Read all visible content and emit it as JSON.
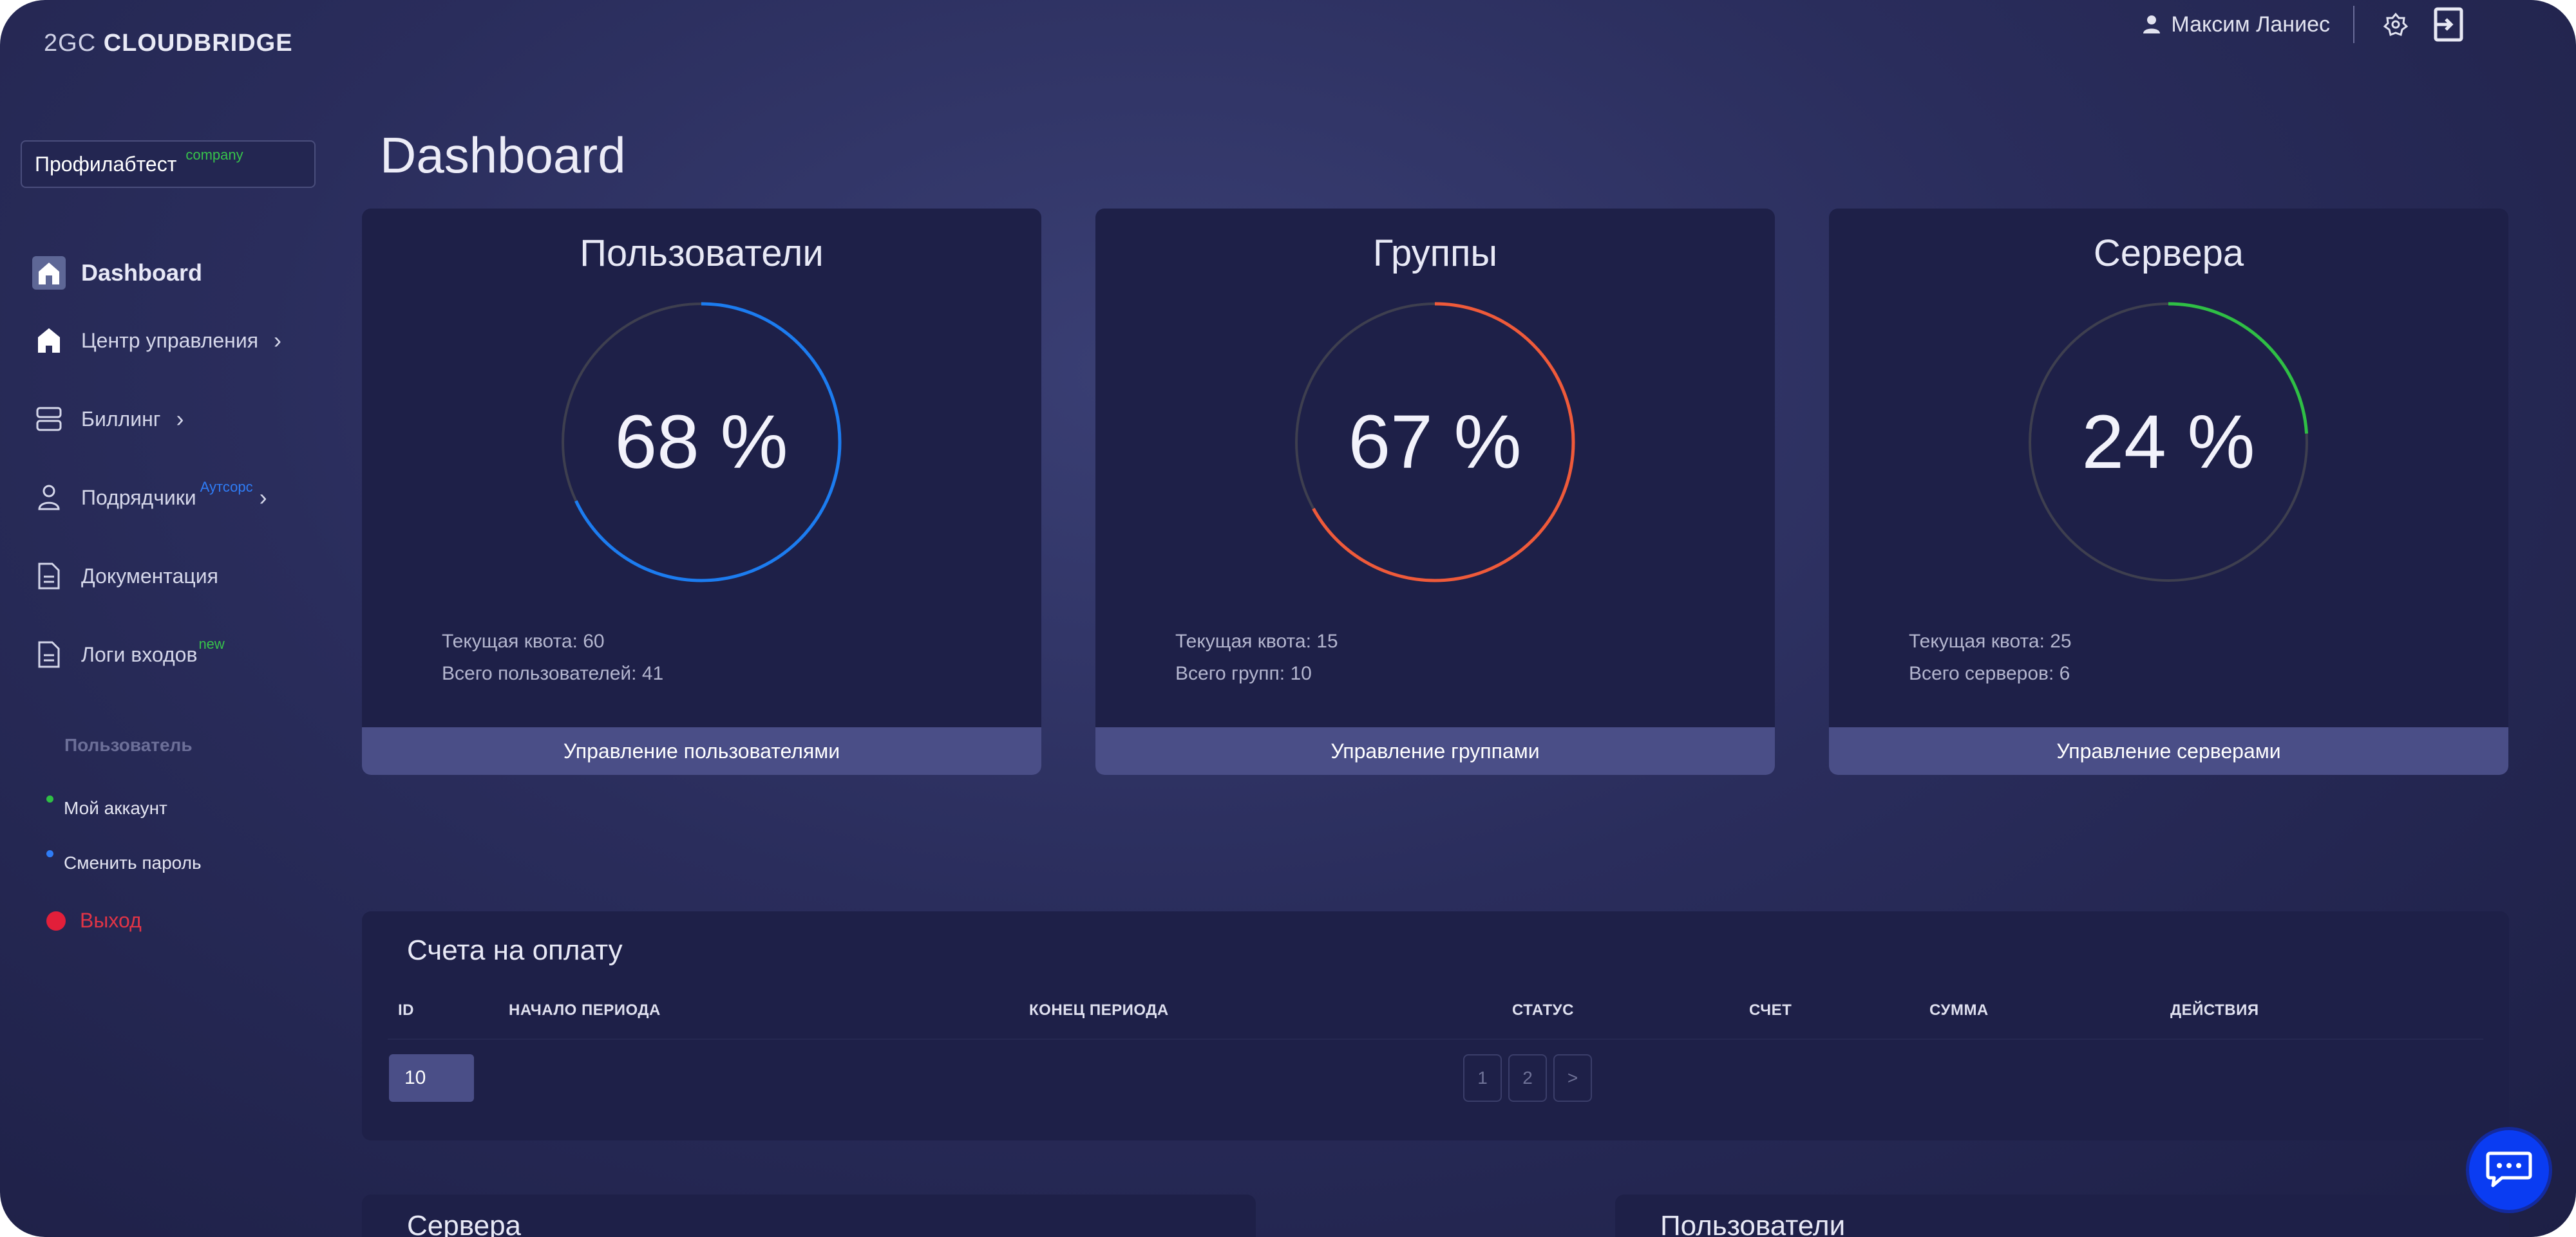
{
  "brand": {
    "prefix": "2GC",
    "name": "CLOUDBRIDGE"
  },
  "header": {
    "user_name": "Максим Ланиес",
    "icons": [
      "user-icon",
      "settings-icon",
      "logout-icon"
    ]
  },
  "company": {
    "name": "Профилабтест",
    "badge": "company"
  },
  "sidebar": {
    "dashboard": "Dashboard",
    "items": [
      {
        "label": "Центр управления",
        "icon": "home-icon",
        "chevron": true
      },
      {
        "label": "Биллинг",
        "icon": "server-icon",
        "chevron": true
      },
      {
        "label": "Подрядчики",
        "icon": "person-icon",
        "badge": "Аутсорс",
        "chevron": true
      },
      {
        "label": "Документация",
        "icon": "document-icon"
      },
      {
        "label": "Логи входов",
        "icon": "document-icon",
        "badge": "new"
      }
    ],
    "section_title": "Пользователь",
    "account_links": [
      {
        "label": "Мой аккаунт",
        "dot_color": "#2fbf45"
      },
      {
        "label": "Сменить пароль",
        "dot_color": "#2f7cf6"
      }
    ],
    "logout": "Выход"
  },
  "page": {
    "title": "Dashboard"
  },
  "cards": [
    {
      "title": "Пользователи",
      "percent": 68,
      "percent_text": "68 %",
      "color": "#1c7cf0",
      "quota": "Текущая квота: 60",
      "total": "Всего пользователей: 41",
      "button": "Управление пользователями"
    },
    {
      "title": "Группы",
      "percent": 67,
      "percent_text": "67 %",
      "color": "#ef5a3a",
      "quota": "Текущая квота: 15",
      "total": "Всего групп: 10",
      "button": "Управление группами"
    },
    {
      "title": "Сервера",
      "percent": 24,
      "percent_text": "24 %",
      "color": "#2fbf45",
      "quota": "Текущая квота: 25",
      "total": "Всего серверов: 6",
      "button": "Управление серверами"
    }
  ],
  "invoices": {
    "title": "Счета на оплату",
    "columns": [
      "ID",
      "НАЧАЛО ПЕРИОДА",
      "КОНЕЦ ПЕРИОДА",
      "СТАТУС",
      "СЧЕТ",
      "СУММА",
      "ДЕЙСТВИЯ"
    ],
    "page_size": "10",
    "pages": [
      "1",
      "2",
      ">"
    ]
  },
  "bottom_panels": [
    "Сервера",
    "Пользователи"
  ]
}
